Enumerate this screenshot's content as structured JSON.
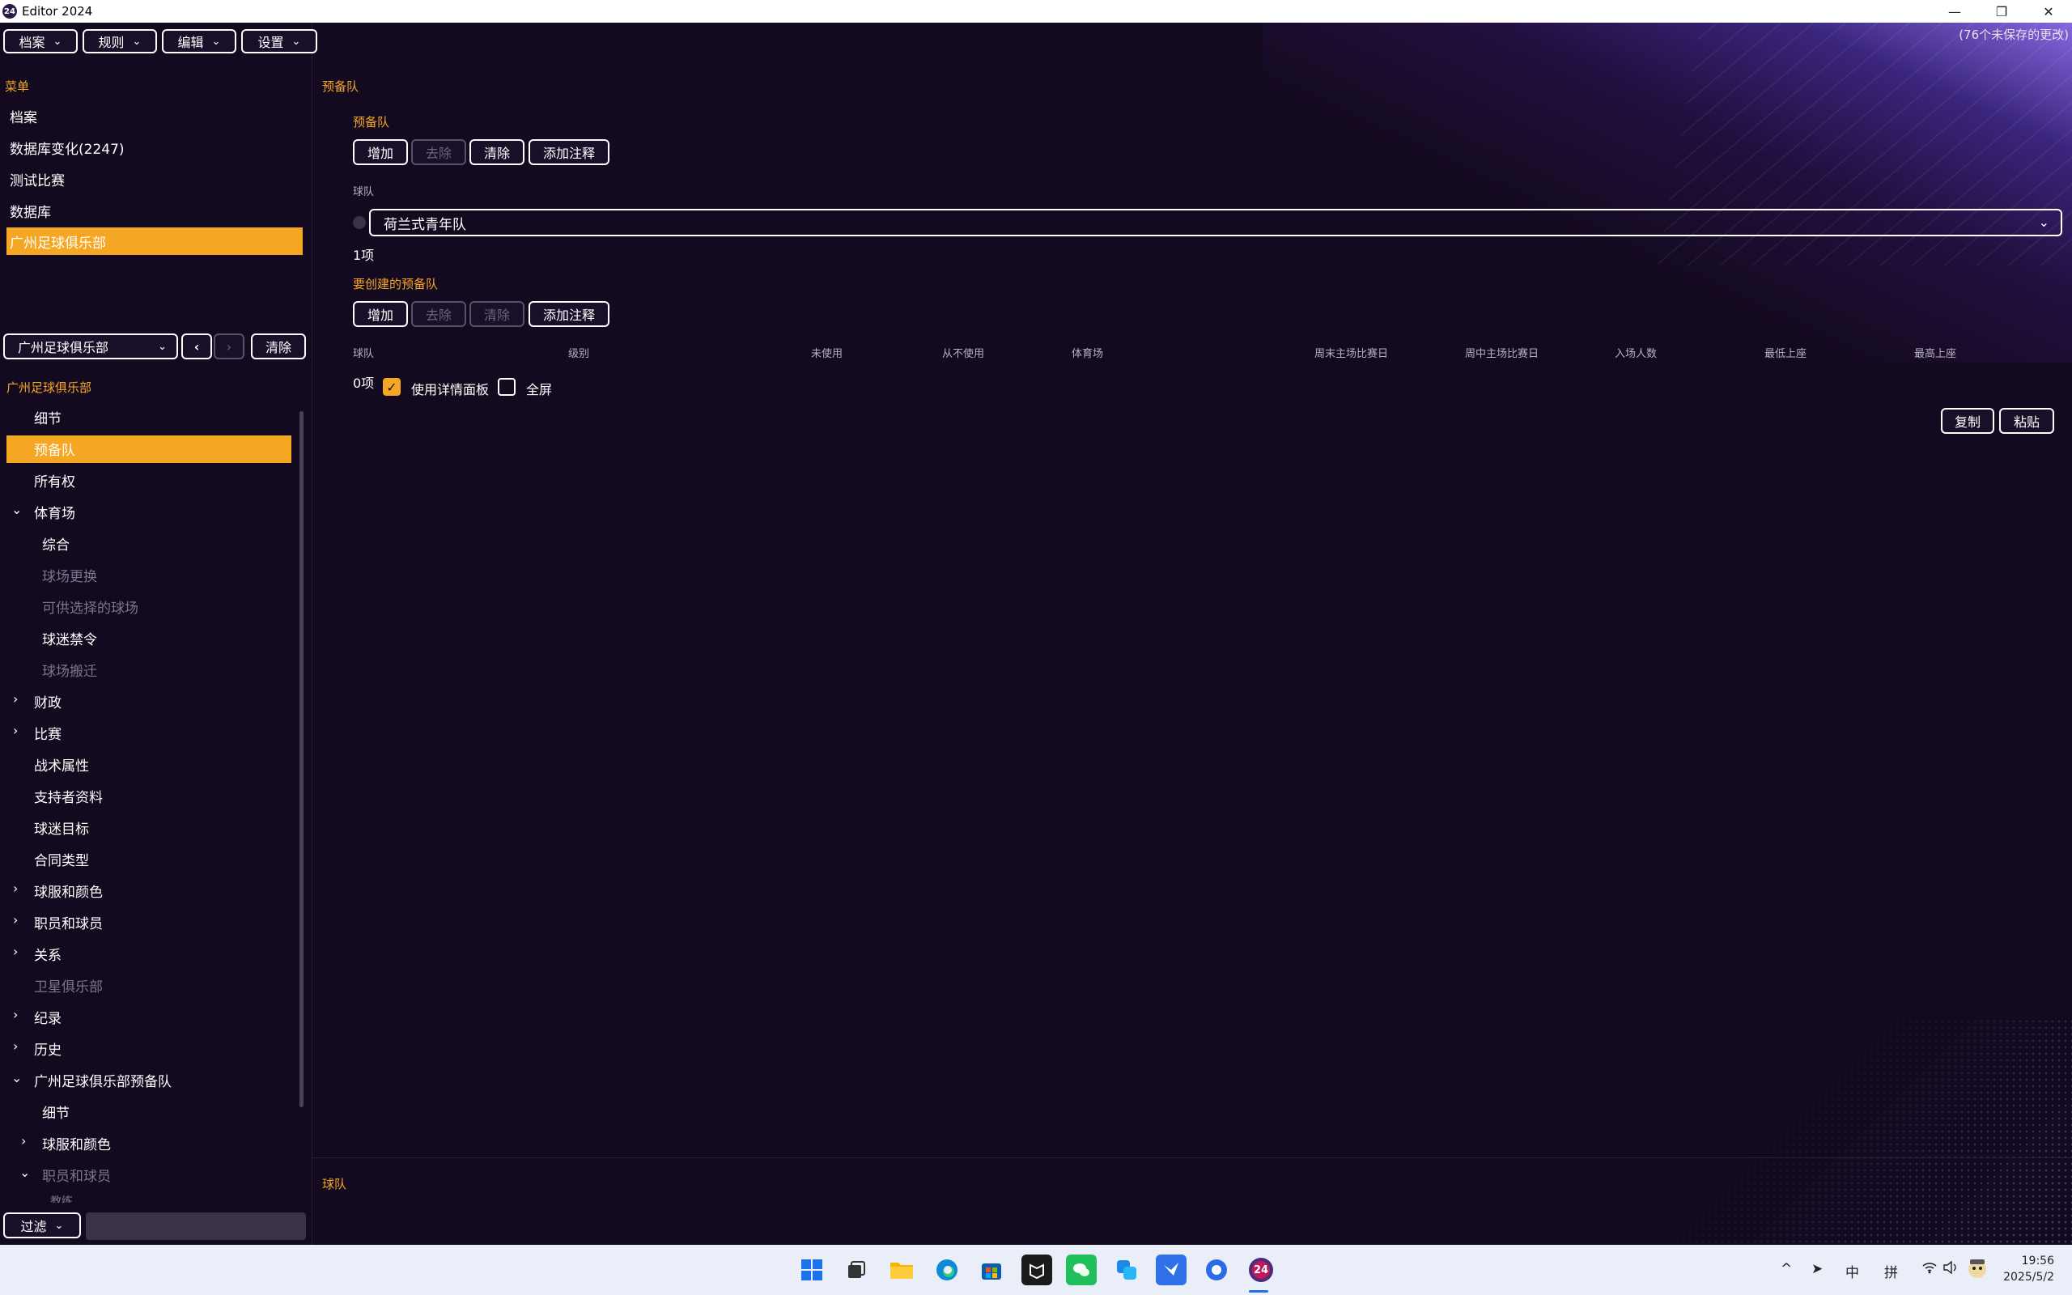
{
  "window": {
    "title": "Editor 2024",
    "app_icon": "24",
    "minimize": "—",
    "restore": "❐",
    "close": "✕"
  },
  "top_menu": {
    "file": "档案",
    "rules": "规则",
    "edit": "编辑",
    "settings": "设置",
    "unsaved": "(76个未保存的更改)"
  },
  "sidebar": {
    "menu_label": "菜单",
    "items": [
      "档案",
      "数据库变化(2247)",
      "测试比赛",
      "数据库",
      "广州足球俱乐部"
    ],
    "club_select": "广州足球俱乐部",
    "clear": "清除",
    "tree_title": "广州足球俱乐部",
    "tree": {
      "details": "细节",
      "reserve": "预备队",
      "ownership": "所有权",
      "stadium": "体育场",
      "general": "综合",
      "ground_change": "球场更换",
      "alt_grounds": "可供选择的球场",
      "fan_ban": "球迷禁令",
      "ground_move": "球场搬迁",
      "finance": "财政",
      "match": "比赛",
      "tactics": "战术属性",
      "supporters": "支持者资料",
      "fan_goals": "球迷目标",
      "contract_types": "合同类型",
      "kits": "球服和颜色",
      "staff_players": "职员和球员",
      "relations": "关系",
      "satellite": "卫星俱乐部",
      "records": "纪录",
      "history": "历史",
      "reserve_club": "广州足球俱乐部预备队",
      "sub_details": "细节",
      "sub_kits": "球服和颜色",
      "sub_staff": "职员和球员",
      "coach": "教练"
    },
    "filter": "过滤"
  },
  "main": {
    "page_title": "预备队",
    "section1": {
      "title": "预备队",
      "add": "增加",
      "remove": "去除",
      "clear": "清除",
      "annotate": "添加注释",
      "team_label": "球队",
      "team_value": "荷兰式青年队",
      "count": "1项"
    },
    "section2": {
      "title": "要创建的预备队",
      "add": "增加",
      "remove": "去除",
      "clear": "清除",
      "annotate": "添加注释",
      "columns": [
        "球队",
        "级别",
        "未使用",
        "从不使用",
        "体育场",
        "周末主场比赛日",
        "周中主场比赛日",
        "入场人数",
        "最低上座",
        "最高上座"
      ],
      "count": "0项",
      "use_detail_panel": "使用详情面板",
      "use_detail_panel_checked": true,
      "fullscreen": "全屏",
      "fullscreen_checked": false
    },
    "copy": "复制",
    "paste": "粘贴",
    "bottom_label": "球队"
  },
  "taskbar": {
    "icons": [
      "windows-start-icon",
      "task-view-icon",
      "file-explorer-icon",
      "edge-browser-icon",
      "store-icon",
      "app-icon-dark",
      "wechat-icon",
      "app-icon-blue",
      "feishu-icon",
      "browser-icon",
      "editor-2024-icon"
    ],
    "tray": {
      "chevron": "^",
      "ime_cn": "中",
      "ime_pinyin": "拼"
    },
    "time": "19:56",
    "date": "2025/5/2"
  },
  "colors": {
    "accent": "#f5a623",
    "background": "#140a20",
    "border": "#ffffff",
    "disabled": "#5a5068"
  }
}
